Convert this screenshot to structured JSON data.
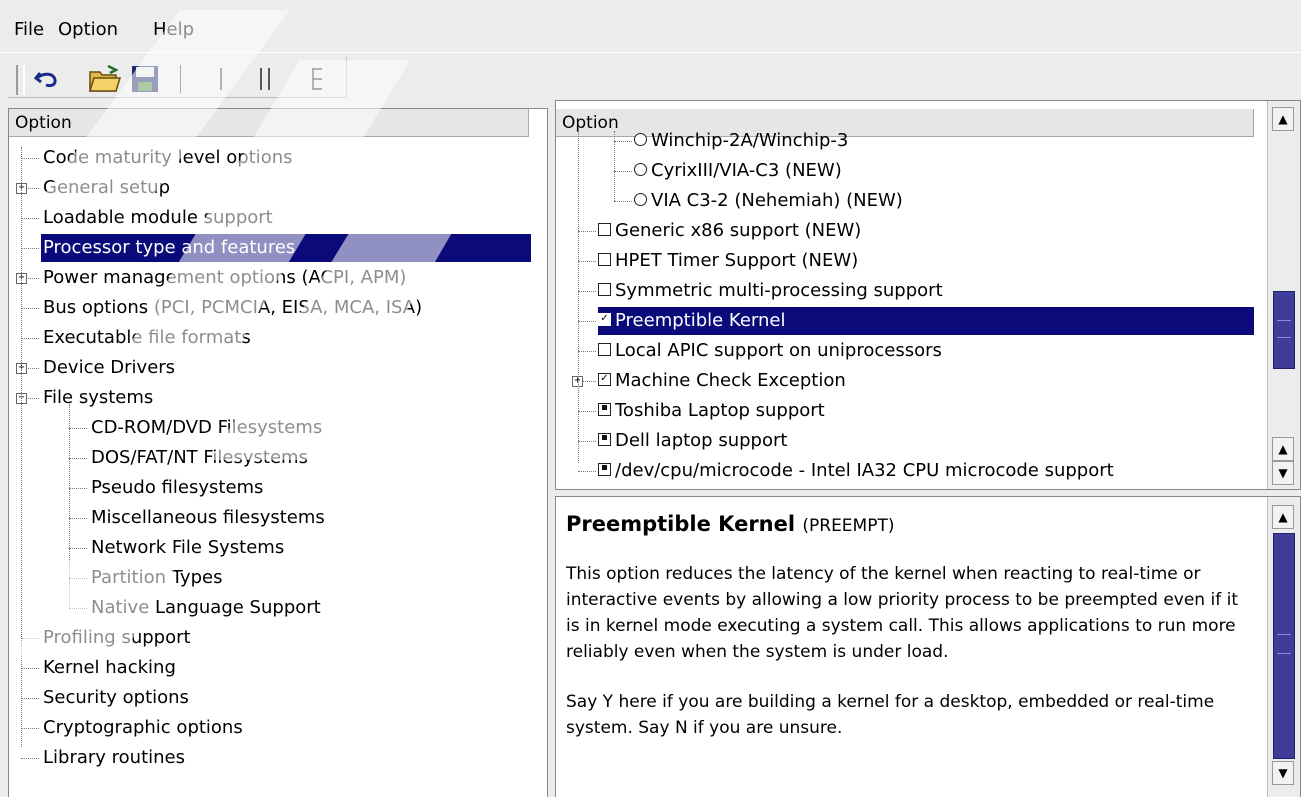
{
  "menu": {
    "file": "File",
    "option": "Option",
    "help": "Help"
  },
  "toolbar": {
    "buttons": [
      "undo-icon",
      "open-folder-icon",
      "save-icon",
      "single-view-icon",
      "split-view-icon",
      "full-view-icon"
    ]
  },
  "left_panel": {
    "header": "Option",
    "items": [
      {
        "label": "Code maturity level options",
        "expander": "none",
        "level": 0
      },
      {
        "label": "General setup",
        "expander": "plus",
        "level": 0
      },
      {
        "label": "Loadable module support",
        "expander": "none",
        "level": 0
      },
      {
        "label": "Processor type and features",
        "expander": "none",
        "level": 0,
        "selected": true
      },
      {
        "label": "Power management options (ACPI, APM)",
        "expander": "plus",
        "level": 0
      },
      {
        "label": "Bus options (PCI, PCMCIA, EISA, MCA, ISA)",
        "expander": "none",
        "level": 0
      },
      {
        "label": "Executable file formats",
        "expander": "none",
        "level": 0
      },
      {
        "label": "Device Drivers",
        "expander": "plus",
        "level": 0
      },
      {
        "label": "File systems",
        "expander": "minus",
        "level": 0
      },
      {
        "label": "CD-ROM/DVD Filesystems",
        "expander": "none",
        "level": 1
      },
      {
        "label": "DOS/FAT/NT Filesystems",
        "expander": "none",
        "level": 1
      },
      {
        "label": "Pseudo filesystems",
        "expander": "none",
        "level": 1
      },
      {
        "label": "Miscellaneous filesystems",
        "expander": "none",
        "level": 1
      },
      {
        "label": "Network File Systems",
        "expander": "none",
        "level": 1
      },
      {
        "label": "Partition Types",
        "expander": "none",
        "level": 1
      },
      {
        "label": "Native Language Support",
        "expander": "none",
        "level": 1
      },
      {
        "label": "Profiling support",
        "expander": "none",
        "level": 0
      },
      {
        "label": "Kernel hacking",
        "expander": "none",
        "level": 0
      },
      {
        "label": "Security options",
        "expander": "none",
        "level": 0
      },
      {
        "label": "Cryptographic options",
        "expander": "none",
        "level": 0
      },
      {
        "label": "Library routines",
        "expander": "none",
        "level": 0
      }
    ]
  },
  "right_panel": {
    "header": "Option",
    "items": [
      {
        "label": "Winchip-2A/Winchip-3",
        "control": "radio",
        "level": 1
      },
      {
        "label": "CyrixIII/VIA-C3 (NEW)",
        "control": "radio",
        "level": 1
      },
      {
        "label": "VIA C3-2 (Nehemiah) (NEW)",
        "control": "radio",
        "level": 1
      },
      {
        "label": "Generic x86 support (NEW)",
        "control": "checkbox",
        "state": "off",
        "level": 0
      },
      {
        "label": "HPET Timer Support (NEW)",
        "control": "checkbox",
        "state": "off",
        "level": 0
      },
      {
        "label": "Symmetric multi-processing support",
        "control": "checkbox",
        "state": "off",
        "level": 0
      },
      {
        "label": "Preemptible Kernel",
        "control": "checkbox",
        "state": "checked",
        "level": 0,
        "selected": true
      },
      {
        "label": "Local APIC support on uniprocessors",
        "control": "checkbox",
        "state": "off",
        "level": 0
      },
      {
        "label": "Machine Check Exception",
        "control": "checkbox",
        "state": "checked",
        "level": 0,
        "expander": "plus"
      },
      {
        "label": "Toshiba Laptop support",
        "control": "checkbox",
        "state": "module",
        "level": 0
      },
      {
        "label": "Dell laptop support",
        "control": "checkbox",
        "state": "module",
        "level": 0
      },
      {
        "label": "/dev/cpu/microcode - Intel IA32 CPU microcode support",
        "control": "checkbox",
        "state": "module",
        "level": 0
      }
    ]
  },
  "help_panel": {
    "title": "Preemptible Kernel",
    "symbol": "(PREEMPT)",
    "paragraphs": [
      "This option reduces the latency of the kernel when reacting to real-time or interactive events by allowing a low priority process to be preempted even if it is in kernel mode executing a system call. This allows applications to run more reliably even when the system is under load.",
      "Say Y here if you are building a kernel for a desktop, embedded or real-time system. Say N if you are unsure."
    ]
  },
  "colors": {
    "selection": "#0a0a7a",
    "scroll_thumb": "#3e3e9a",
    "background": "#ececec"
  }
}
